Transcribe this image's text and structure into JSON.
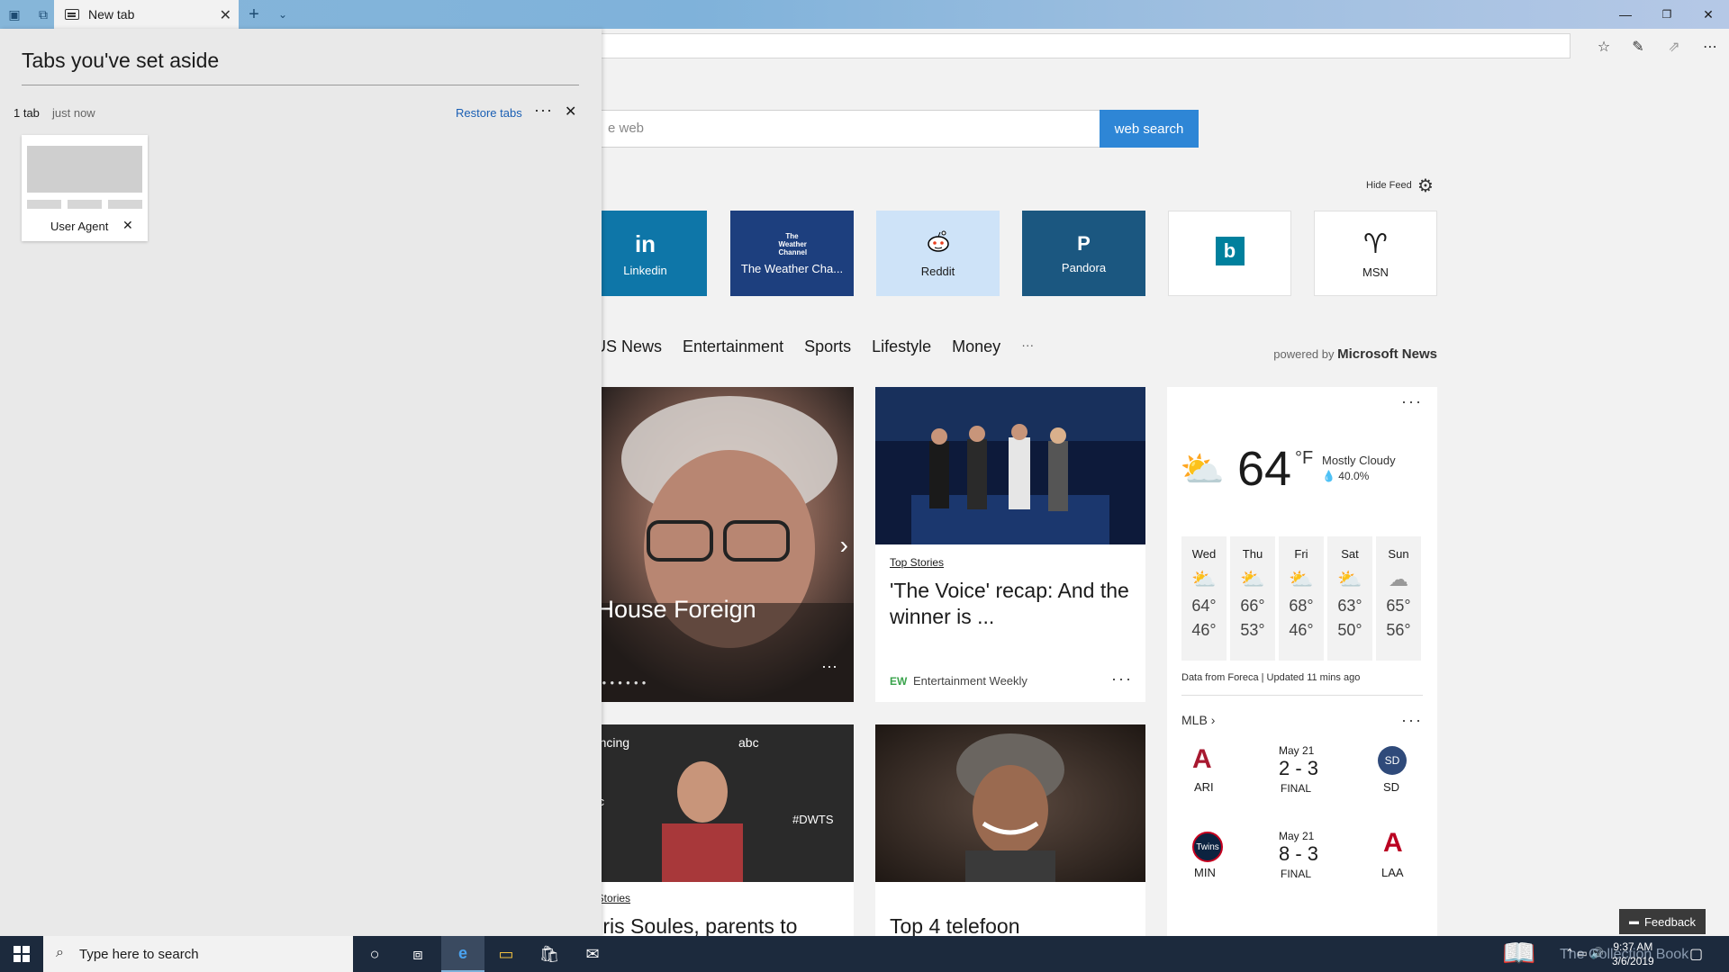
{
  "browser": {
    "tab_title": "New tab",
    "address_value": ""
  },
  "aside_panel": {
    "title": "Tabs you've set aside",
    "count_label": "1 tab",
    "time_label": "just now",
    "restore_label": "Restore tabs",
    "tab_card_label": "User Agent"
  },
  "search": {
    "placeholder": "e web",
    "button_label": "web search"
  },
  "feed": {
    "hide_label": "Hide Feed"
  },
  "tiles": [
    {
      "label": "Linkedin",
      "icon_text": "in",
      "bg": "#0e76a8",
      "fg": "#ffffff"
    },
    {
      "label": "The Weather Cha...",
      "icon_text": "The Weather Channel",
      "bg": "#1d3f7e",
      "fg": "#ffffff"
    },
    {
      "label": "Reddit",
      "icon_text": "reddit-icon",
      "bg": "#cee3f8",
      "fg": "#1b1b1b"
    },
    {
      "label": "Pandora",
      "icon_text": "P",
      "bg": "#1b5780",
      "fg": "#ffffff"
    },
    {
      "label": "",
      "icon_text": "b",
      "bg": "#ffffff",
      "fg": "#00809d"
    },
    {
      "label": "MSN",
      "icon_text": "msn-icon",
      "bg": "#ffffff",
      "fg": "#1b1b1b"
    }
  ],
  "categories": [
    "US News",
    "Entertainment",
    "Sports",
    "Lifestyle",
    "Money",
    "···"
  ],
  "powered_by": {
    "prefix": "powered by",
    "brand": "Microsoft News"
  },
  "cards": {
    "hero": {
      "title": "h House Foreign"
    },
    "voice": {
      "tag": "Top Stories",
      "title": "'The Voice' recap: And the winner is ...",
      "source": "Entertainment Weekly",
      "source_badge": "EW"
    },
    "dwts": {
      "tag": "Top Stories",
      "title": "Chris Soules, parents to"
    },
    "telefoon": {
      "title": "Top 4 telefoon"
    }
  },
  "weather": {
    "temp": "64",
    "unit": "°F",
    "condition": "Mostly Cloudy",
    "precip": "40.0%",
    "days": [
      {
        "day": "Wed",
        "hi": "64°",
        "lo": "46°"
      },
      {
        "day": "Thu",
        "hi": "66°",
        "lo": "53°"
      },
      {
        "day": "Fri",
        "hi": "68°",
        "lo": "46°"
      },
      {
        "day": "Sat",
        "hi": "63°",
        "lo": "50°"
      },
      {
        "day": "Sun",
        "hi": "65°",
        "lo": "56°"
      }
    ],
    "source_note": "Data from Foreca | Updated 11 mins ago"
  },
  "mlb": {
    "title": "MLB",
    "games": [
      {
        "date": "May 21",
        "score": "2 - 3",
        "status": "FINAL",
        "home": "ARI",
        "away": "SD"
      },
      {
        "date": "May 21",
        "score": "8 - 3",
        "status": "FINAL",
        "home": "MIN",
        "away": "LAA"
      }
    ]
  },
  "feedback_label": "Feedback",
  "taskbar": {
    "search_placeholder": "Type here to search",
    "time": "9:37 AM",
    "date": "3/6/2019",
    "watermark": "The Collection Book"
  },
  "colors": {
    "accent": "#2e86d6",
    "taskbar": "#1c2a3d",
    "titlebar": "#86b6d9"
  }
}
